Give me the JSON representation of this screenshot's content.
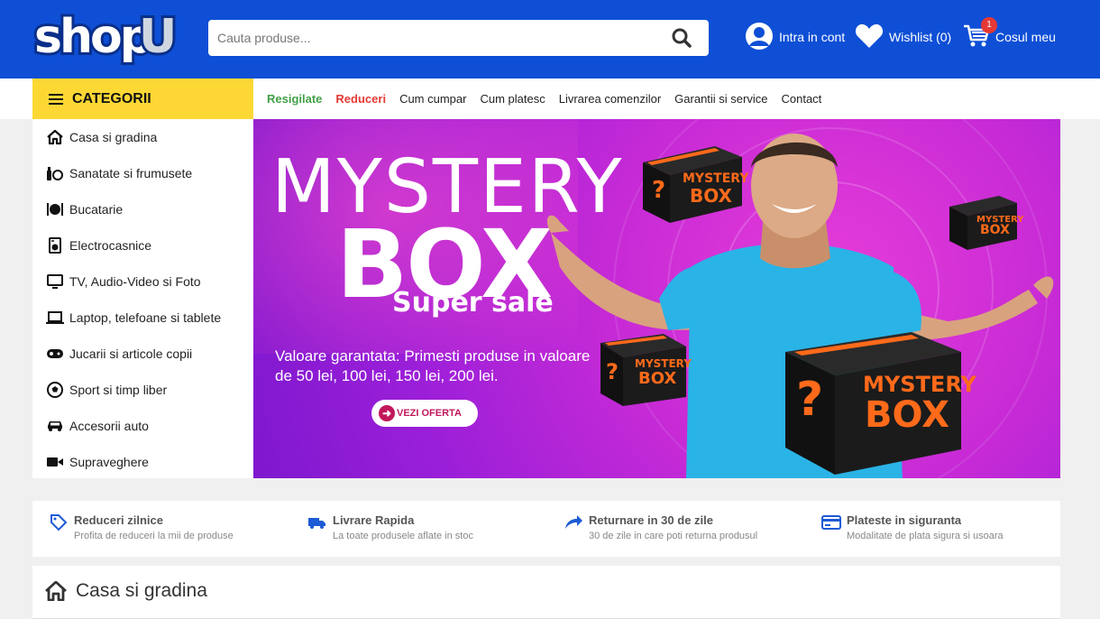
{
  "header": {
    "logo_text": "shopU",
    "search_placeholder": "Cauta produse...",
    "account_label": "Intra in cont",
    "wishlist_label": "Wishlist (0)",
    "cart_label": "Cosul meu",
    "cart_count": "1"
  },
  "nav": {
    "categories_label": "CATEGORII",
    "links": [
      "Resigilate",
      "Reduceri",
      "Cum cumpar",
      "Cum platesc",
      "Livrarea comenzilor",
      "Garantii si service",
      "Contact"
    ]
  },
  "sidebar": {
    "items": [
      {
        "label": "Casa si gradina",
        "icon": "home-icon"
      },
      {
        "label": "Sanatate si frumusete",
        "icon": "beauty-icon"
      },
      {
        "label": "Bucatarie",
        "icon": "kitchen-icon"
      },
      {
        "label": "Electrocasnice",
        "icon": "washer-icon"
      },
      {
        "label": "TV, Audio-Video si Foto",
        "icon": "monitor-icon"
      },
      {
        "label": "Laptop, telefoane si tablete",
        "icon": "laptop-icon"
      },
      {
        "label": "Jucarii si articole copii",
        "icon": "gamepad-icon"
      },
      {
        "label": "Sport si timp liber",
        "icon": "ball-icon"
      },
      {
        "label": "Accesorii auto",
        "icon": "car-icon"
      },
      {
        "label": "Supraveghere",
        "icon": "camera-icon"
      }
    ]
  },
  "banner": {
    "line1": "MYSTERY",
    "line2": "BOX",
    "line3": "Super sale",
    "description": "Valoare garantata: Primesti produse in valoare de 50 lei, 100 lei, 150 lei, 200 lei.",
    "cta": "VEZI OFERTA",
    "box_text_1": "MYSTERY",
    "box_text_2": "BOX",
    "box_mark": "?"
  },
  "features": [
    {
      "title": "Reduceri zilnice",
      "subtitle": "Profita de reduceri la mii de produse",
      "icon": "tag-icon"
    },
    {
      "title": "Livrare Rapida",
      "subtitle": "La toate produsele aflate in stoc",
      "icon": "truck-icon"
    },
    {
      "title": "Returnare in 30 de zile",
      "subtitle": "30 de zile in care poti returna produsul",
      "icon": "return-arrow-icon"
    },
    {
      "title": "Plateste in siguranta",
      "subtitle": "Modalitate de plata sigura si usoara",
      "icon": "card-icon"
    }
  ],
  "section": {
    "title": "Casa si gradina"
  },
  "colors": {
    "header_bg": "#0e4fd6",
    "categories_bg": "#fdd835",
    "resigilate": "#43a047",
    "reduceri": "#e53935",
    "box_orange": "#ff6a1a",
    "feature_icon": "#1e5bd6"
  }
}
